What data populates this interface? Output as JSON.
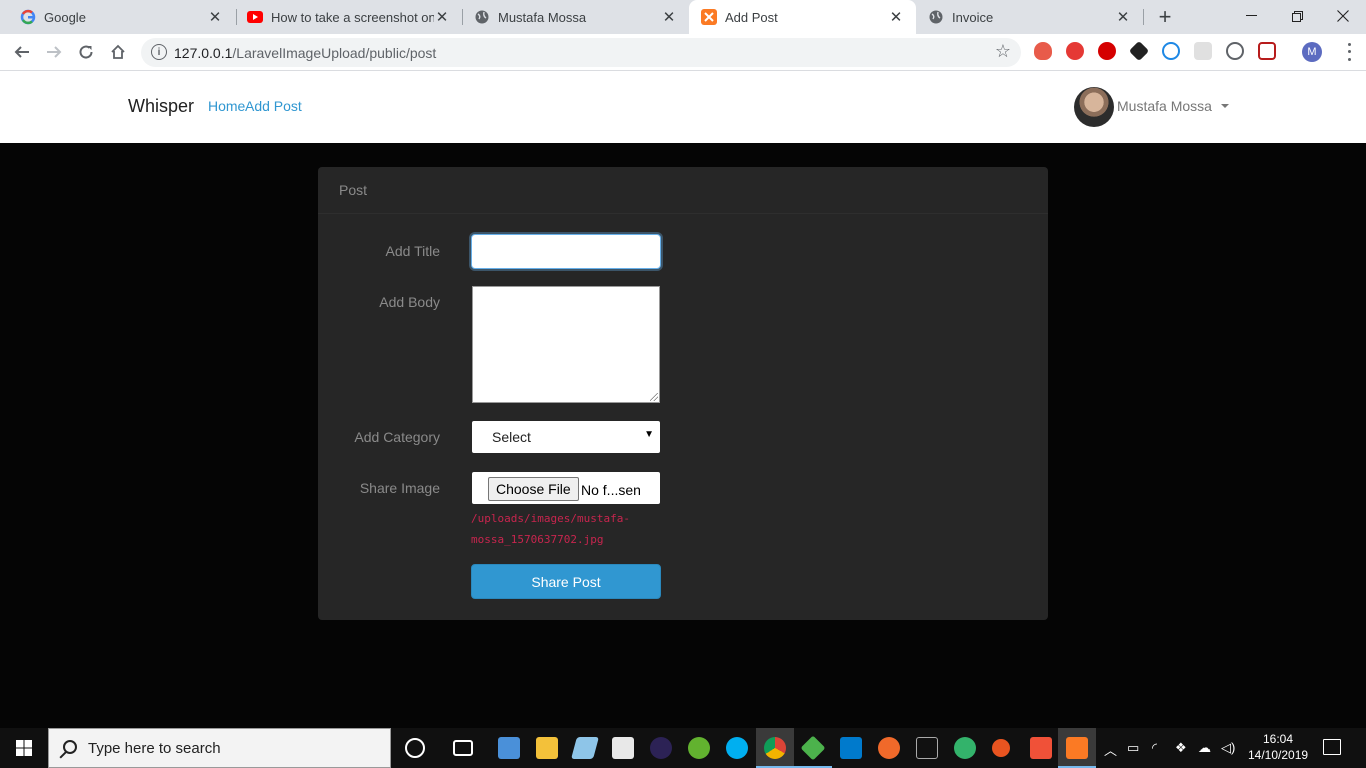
{
  "browser": {
    "tabs": [
      {
        "title": "Google",
        "icon": "google-icon",
        "active": false
      },
      {
        "title": "How to take a screenshot on w",
        "icon": "youtube-icon",
        "active": false
      },
      {
        "title": "Mustafa Mossa",
        "icon": "globe-icon",
        "active": false
      },
      {
        "title": "Add Post",
        "icon": "xampp-icon",
        "active": true
      },
      {
        "title": "Invoice",
        "icon": "globe-icon",
        "active": false
      }
    ],
    "url_host": "127.0.0.1",
    "url_path": "/LaravelImageUpload/public/post",
    "profile_initial": "M"
  },
  "site": {
    "brand": "Whisper",
    "nav": [
      "Home",
      "Add Post"
    ],
    "user_name": "Mustafa Mossa"
  },
  "form": {
    "panel_title": "Post",
    "title_label": "Add Title",
    "title_value": "",
    "body_label": "Add Body",
    "body_value": "",
    "category_label": "Add Category",
    "category_selected": "Select",
    "image_label": "Share Image",
    "choose_file_label": "Choose File",
    "file_status": "No f...sen",
    "image_path": "/uploads/images/mustafa-mossa_1570637702.jpg",
    "submit_label": "Share Post"
  },
  "taskbar": {
    "search_placeholder": "Type here to search",
    "time": "16:04",
    "date": "14/10/2019"
  },
  "colors": {
    "accent": "#3097d1",
    "panel": "#262626",
    "page_bg": "#050505",
    "path_text": "#c7254e"
  }
}
